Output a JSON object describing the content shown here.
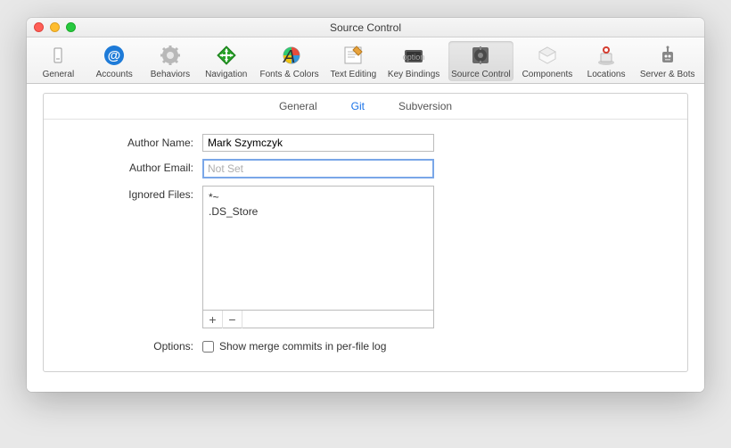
{
  "window_title": "Source Control",
  "toolbar": [
    {
      "id": "general",
      "label": "General"
    },
    {
      "id": "accounts",
      "label": "Accounts"
    },
    {
      "id": "behaviors",
      "label": "Behaviors"
    },
    {
      "id": "navigation",
      "label": "Navigation"
    },
    {
      "id": "fonts-colors",
      "label": "Fonts & Colors"
    },
    {
      "id": "text-editing",
      "label": "Text Editing"
    },
    {
      "id": "key-bindings",
      "label": "Key Bindings"
    },
    {
      "id": "source-control",
      "label": "Source Control"
    },
    {
      "id": "components",
      "label": "Components"
    },
    {
      "id": "locations",
      "label": "Locations"
    },
    {
      "id": "server-bots",
      "label": "Server & Bots"
    }
  ],
  "active_toolbar": "source-control",
  "subtabs": [
    {
      "id": "general",
      "label": "General"
    },
    {
      "id": "git",
      "label": "Git"
    },
    {
      "id": "subversion",
      "label": "Subversion"
    }
  ],
  "active_subtab": "git",
  "labels": {
    "author_name": "Author Name:",
    "author_email": "Author Email:",
    "ignored_files": "Ignored Files:",
    "options": "Options:"
  },
  "fields": {
    "author_name_value": "Mark Szymczyk",
    "author_email_value": "",
    "author_email_placeholder": "Not Set"
  },
  "ignored_files": [
    "*~",
    ".DS_Store"
  ],
  "buttons": {
    "add": "+",
    "remove": "−"
  },
  "checkbox": {
    "checked": false,
    "label": "Show merge commits in per-file log"
  }
}
